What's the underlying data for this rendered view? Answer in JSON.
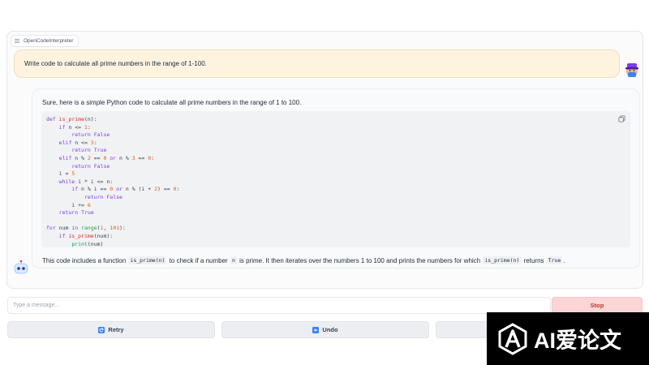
{
  "panel": {
    "label": "OpenCodeInterpreter"
  },
  "user_message": "Write code to calculate all prime numbers in the range of 1-100.",
  "bot": {
    "intro": "Sure, here is a simple Python code to calculate all prime numbers in the range of 1 to 100.",
    "code_lines": [
      "def is_prime(n):",
      "    if n <= 1:",
      "        return False",
      "    elif n <= 3:",
      "        return True",
      "    elif n % 2 == 0 or n % 3 == 0:",
      "        return False",
      "    i = 5",
      "    while i * i <= n:",
      "        if n % i == 0 or n % (i + 2) == 0:",
      "            return False",
      "        i += 6",
      "    return True",
      "",
      "for num in range(1, 101):",
      "    if is_prime(num):",
      "        print(num)"
    ],
    "outro": {
      "t1": "This code includes a function ",
      "c1": "is_prime(n)",
      "t2": " to check if a number ",
      "c2": "n",
      "t3": " is prime. It then iterates over the numbers 1 to 100 and prints the numbers for which ",
      "c3": "is_prime(n)",
      "t4": " returns ",
      "c4": "True",
      "t5": "."
    }
  },
  "input": {
    "placeholder": "Type a message..."
  },
  "buttons": {
    "stop": "Stop",
    "retry": "Retry",
    "undo": "Undo"
  },
  "watermark": {
    "text": "AI爱论文"
  },
  "colors": {
    "user_bubble": "#fdf3df",
    "stop_bg": "#fcd6d6",
    "keyword": "#7c3aed"
  }
}
